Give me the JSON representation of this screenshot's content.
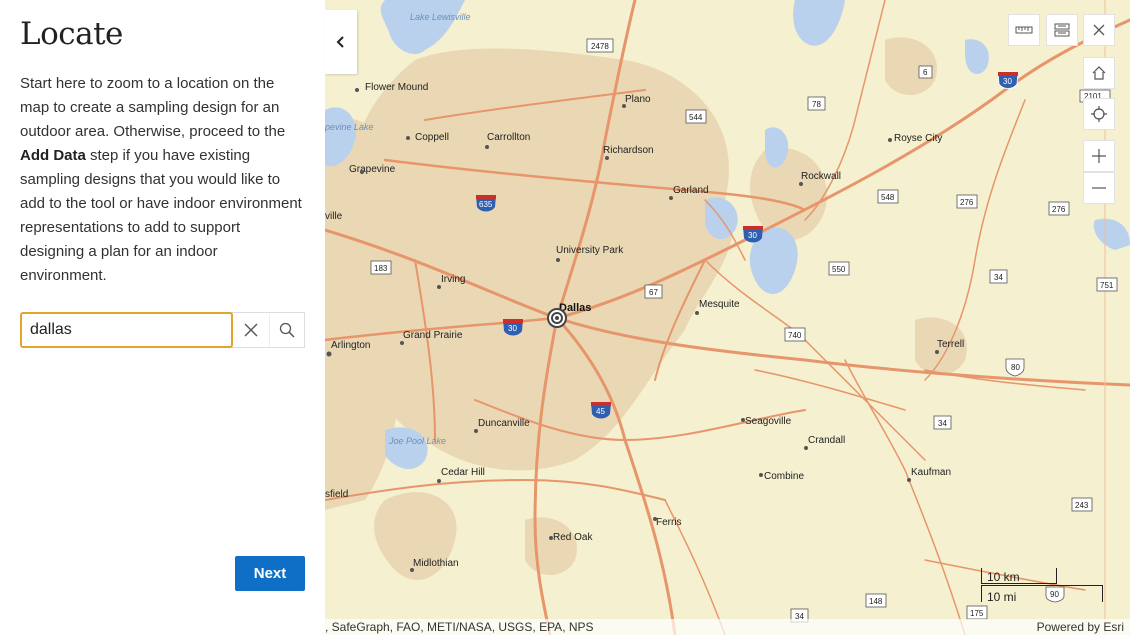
{
  "panel": {
    "title": "Locate",
    "intro_1": "Start here to zoom to a location on the map to create a sampling design for an outdoor area. Otherwise, proceed to the ",
    "intro_bold": "Add Data",
    "intro_2": " step if you have existing sampling designs that you would like to add to the tool or have indoor environment representations to add to support designing a plan for an indoor environment.",
    "search_value": "dallas",
    "next_label": "Next"
  },
  "map": {
    "places": {
      "dallas": "Dallas",
      "plano": "Plano",
      "carrollton": "Carrollton",
      "richardson": "Richardson",
      "garland": "Garland",
      "rockwall": "Rockwall",
      "royse_city": "Royse City",
      "flower_mound": "Flower Mound",
      "coppell": "Coppell",
      "grapevine": "Grapevine",
      "university_park": "University Park",
      "irving": "Irving",
      "grand_prairie": "Grand Prairie",
      "arlington": "Arlington",
      "mesquite": "Mesquite",
      "terrell": "Terrell",
      "duncanville": "Duncanville",
      "seagoville": "Seagoville",
      "crandall": "Crandall",
      "cedar_hill": "Cedar Hill",
      "combine": "Combine",
      "kaufman": "Kaufman",
      "ferris": "Ferris",
      "red_oak": "Red Oak",
      "midlothian": "Midlothian",
      "lake_lewisville": "Lake Lewisville",
      "joe_pool_lake": "Joe Pool Lake",
      "grapevine_lake": "pevine Lake",
      "colleyville": "ville",
      "mansfield": "sfield"
    },
    "shields": {
      "r2478": "2478",
      "r6": "6",
      "i30_ne": "30",
      "r78": "78",
      "r544": "544",
      "r2101": "2101",
      "i635": "635",
      "r548": "548",
      "r276": "276",
      "r276b": "276",
      "i30_mid": "30",
      "r183": "183",
      "r550": "550",
      "r34": "34",
      "r751": "751",
      "r67": "67",
      "i30_w": "30",
      "r740": "740",
      "us80": "80",
      "i45": "45",
      "r34b": "34",
      "r243": "243",
      "r148": "148",
      "r175": "175",
      "r34c": "34",
      "r90": "90"
    },
    "scale_km": "10 km",
    "scale_mi": "10 mi",
    "attribution_left": ", SafeGraph, FAO, METI/NASA, USGS, EPA, NPS",
    "attribution_right": "Powered by Esri"
  },
  "icons": {
    "collapse": "chevron-left-icon",
    "measure": "ruler-icon",
    "basemap": "basemap-toggle-icon",
    "close": "close-icon",
    "home": "home-icon",
    "locate": "crosshair-icon",
    "zoom_in": "plus-icon",
    "zoom_out": "minus-icon",
    "search": "search-icon",
    "clear": "close-icon"
  },
  "colors": {
    "accent": "#0f6fc6",
    "focus": "#e0a52a",
    "map_bg": "#f5f0cf",
    "urban": "#e9d7b3",
    "water": "#b8d0ec",
    "road": "#e8956b"
  }
}
